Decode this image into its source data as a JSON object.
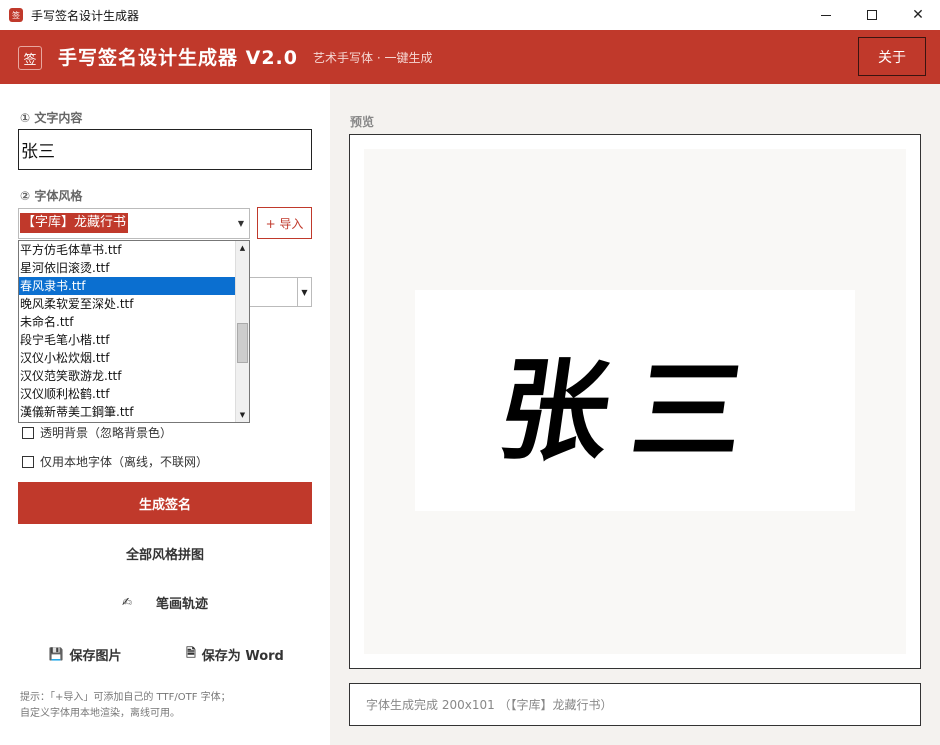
{
  "window": {
    "title": "手写签名设计生成器",
    "icon_text": "签",
    "controls": [
      "minimize",
      "maximize",
      "close"
    ]
  },
  "header": {
    "logo": "签",
    "title": "手写签名设计生成器  V2.0",
    "subtitle": "艺术手写体 · 一键生成",
    "about_label": "关于",
    "accent_color": "#c0392b"
  },
  "form": {
    "text_label": "① 文字内容",
    "text_value": "张三",
    "font_label": "② 字体风格",
    "font_selected": "【字库】龙藏行书",
    "import_label": "+ 导入",
    "font_options": [
      "平方仿毛体草书.ttf",
      "星河依旧滚烫.ttf",
      "春风隶书.ttf",
      "晚风柔软爱至深处.ttf",
      "未命名.ttf",
      "段宁毛笔小楷.ttf",
      "汉仪小松炊烟.ttf",
      "汉仪范笑歌游龙.ttf",
      "汉仪顺利松鹤.ttf",
      "漢儀新蒂美工鋼筆.ttf"
    ],
    "highlighted_option_index": 2,
    "transparent_label": "透明背景（忽略背景色）",
    "local_font_label": "仅用本地字体（离线，不联网）"
  },
  "actions": {
    "generate": "生成签名",
    "all_styles": "全部风格拼图",
    "stroke": "笔画轨迹",
    "save_image": "保存图片",
    "save_word": "保存为 Word"
  },
  "hint": {
    "line1": "提示：「+导入」可添加自己的 TTF/OTF 字体；",
    "line2": "自定义字体用本地渲染，离线可用。"
  },
  "preview": {
    "label": "预览",
    "signature_text": "张三",
    "status": "字体生成完成 200x101 （【字库】龙藏行书）"
  }
}
